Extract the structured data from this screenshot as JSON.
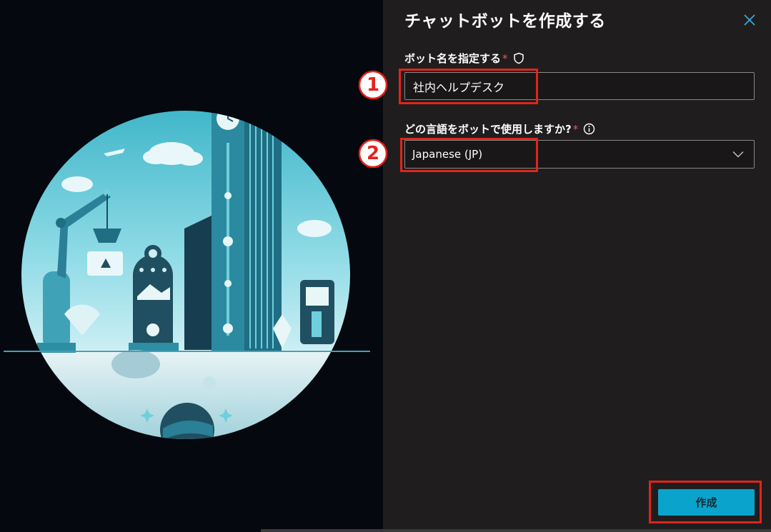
{
  "dialog": {
    "title": "チャットボットを作成する",
    "close_icon": "close-icon"
  },
  "bot_name": {
    "label": "ボット名を指定する",
    "required_mark": "*",
    "icon": "shield-icon",
    "value": "社内ヘルプデスク"
  },
  "language": {
    "label": "どの言語をボットで使用しますか?",
    "required_mark": "*",
    "icon": "info-icon",
    "selected": "Japanese (JP)",
    "chevron_icon": "chevron-down-icon"
  },
  "annotations": {
    "step_1": "1",
    "step_2": "2",
    "highlight_color": "#e0241c"
  },
  "footer": {
    "create_label": "作成"
  },
  "colors": {
    "accent": "#0aa3cc",
    "panel_bg": "#201d1e",
    "illustration_bg": "#05080e",
    "required": "#e05a5a"
  }
}
